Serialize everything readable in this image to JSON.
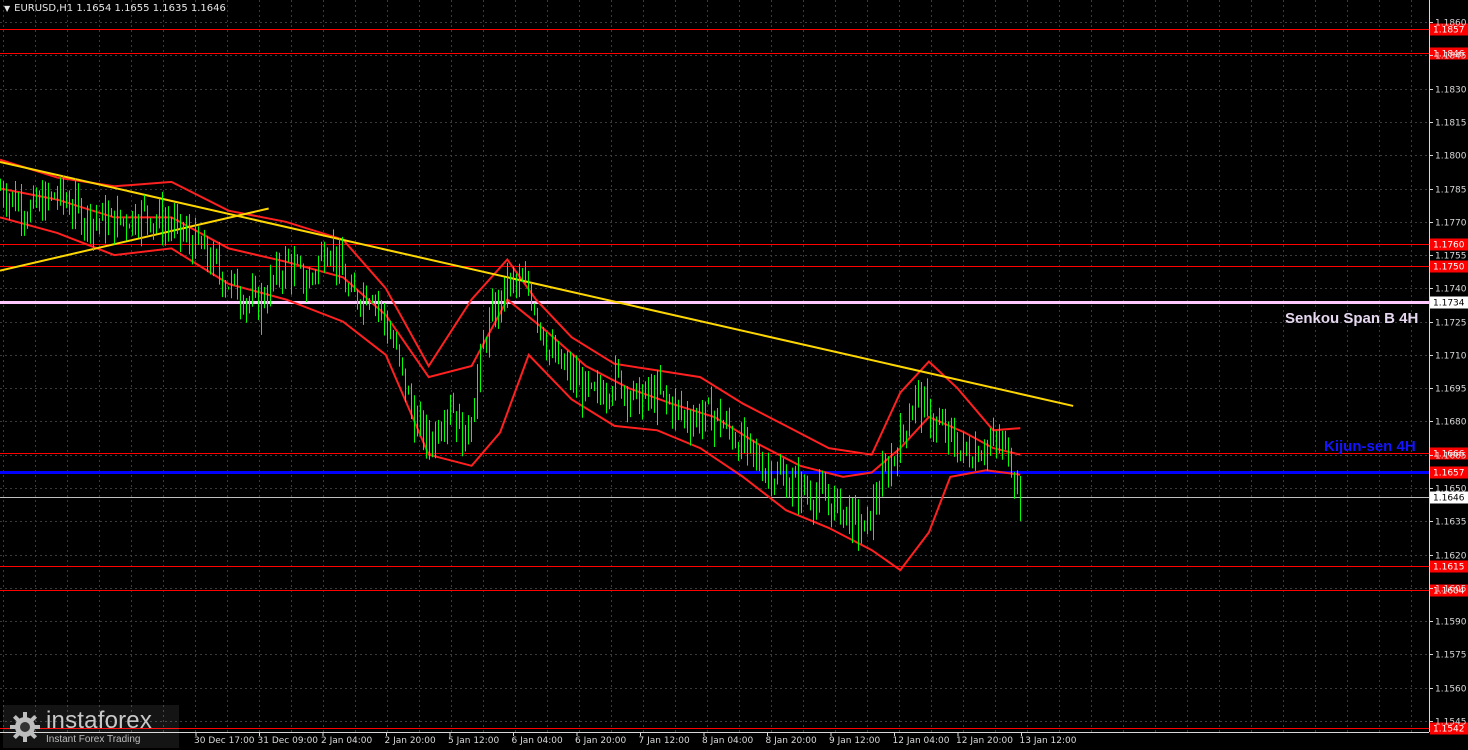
{
  "header": {
    "symbol": "EURUSD,H1",
    "ohlc": "1.1654 1.1655 1.1635 1.1646"
  },
  "watermark": {
    "brand": "instaforex",
    "tagline": "Instant Forex Trading"
  },
  "labels": {
    "senkou": "Senkou Span B 4H",
    "kijun": "Kijun-sen 4H"
  },
  "colors": {
    "background": "#000000",
    "grid": "#3a3a3a",
    "candles": "#00ff00",
    "support_resistance": "#ff0000",
    "senkou_span_b": "#ffc8ff",
    "kijun_sen": "#0000ff",
    "trend_line": "#ffd700",
    "bollinger_bands": "#ff2020",
    "current_price_line": "#bfbfbf"
  },
  "chart_data": {
    "type": "candlestick",
    "symbol": "EURUSD",
    "timeframe": "H1",
    "ylim": [
      1.154,
      1.187
    ],
    "y_ticks": [
      "1.1860",
      "1.1845",
      "1.1830",
      "1.1815",
      "1.1800",
      "1.1785",
      "1.1770",
      "1.1755",
      "1.1740",
      "1.1725",
      "1.1710",
      "1.1695",
      "1.1680",
      "1.1665",
      "1.1650",
      "1.1635",
      "1.1620",
      "1.1605",
      "1.1590",
      "1.1575",
      "1.1560",
      "1.1545"
    ],
    "x_ticks": [
      "30 Dec 17:00",
      "31 Dec 09:00",
      "2 Jan 04:00",
      "2 Jan 20:00",
      "5 Jan 12:00",
      "6 Jan 04:00",
      "6 Jan 20:00",
      "7 Jan 12:00",
      "8 Jan 04:00",
      "8 Jan 20:00",
      "9 Jan 12:00",
      "12 Jan 04:00",
      "12 Jan 20:00",
      "13 Jan 12:00"
    ],
    "price_levels": [
      {
        "label": "1.1857",
        "value": 1.1857,
        "type": "resistance"
      },
      {
        "label": "1.1846",
        "value": 1.1846,
        "type": "resistance"
      },
      {
        "label": "1.1760",
        "value": 1.176,
        "type": "resistance"
      },
      {
        "label": "1.1750",
        "value": 1.175,
        "type": "resistance"
      },
      {
        "label": "1.1734",
        "value": 1.1734,
        "type": "senkou_span_b"
      },
      {
        "label": "1.1666",
        "value": 1.1666,
        "type": "resistance"
      },
      {
        "label": "1.1657",
        "value": 1.1657,
        "type": "kijun_sen"
      },
      {
        "label": "1.1646",
        "value": 1.1646,
        "type": "current_price"
      },
      {
        "label": "1.1615",
        "value": 1.1615,
        "type": "support"
      },
      {
        "label": "1.1604",
        "value": 1.1604,
        "type": "support"
      },
      {
        "label": "1.1542",
        "value": 1.1542,
        "type": "support"
      }
    ],
    "trend_lines": [
      {
        "name": "descending",
        "points": [
          [
            0.0,
            1.1797
          ],
          [
            0.751,
            1.1687
          ]
        ]
      },
      {
        "name": "ascending",
        "points": [
          [
            0.0,
            1.1748
          ],
          [
            0.188,
            1.1776
          ]
        ]
      }
    ],
    "close_path": [
      [
        0.0,
        1.1785
      ],
      [
        0.02,
        1.1775
      ],
      [
        0.04,
        1.1782
      ],
      [
        0.06,
        1.1772
      ],
      [
        0.08,
        1.177
      ],
      [
        0.1,
        1.1774
      ],
      [
        0.12,
        1.1768
      ],
      [
        0.14,
        1.1758
      ],
      [
        0.16,
        1.1742
      ],
      [
        0.18,
        1.1732
      ],
      [
        0.2,
        1.1752
      ],
      [
        0.215,
        1.1742
      ],
      [
        0.23,
        1.1762
      ],
      [
        0.245,
        1.1735
      ],
      [
        0.26,
        1.174
      ],
      [
        0.275,
        1.1715
      ],
      [
        0.29,
        1.168
      ],
      [
        0.3,
        1.167
      ],
      [
        0.315,
        1.169
      ],
      [
        0.325,
        1.167
      ],
      [
        0.34,
        1.172
      ],
      [
        0.355,
        1.1742
      ],
      [
        0.37,
        1.174
      ],
      [
        0.385,
        1.171
      ],
      [
        0.4,
        1.17
      ],
      [
        0.415,
        1.169
      ],
      [
        0.43,
        1.17
      ],
      [
        0.445,
        1.169
      ],
      [
        0.46,
        1.1692
      ],
      [
        0.48,
        1.1682
      ],
      [
        0.5,
        1.1683
      ],
      [
        0.515,
        1.1672
      ],
      [
        0.53,
        1.1662
      ],
      [
        0.545,
        1.1655
      ],
      [
        0.56,
        1.165
      ],
      [
        0.575,
        1.1645
      ],
      [
        0.59,
        1.164
      ],
      [
        0.605,
        1.163
      ],
      [
        0.615,
        1.165
      ],
      [
        0.63,
        1.1672
      ],
      [
        0.64,
        1.1692
      ],
      [
        0.65,
        1.1682
      ],
      [
        0.66,
        1.1675
      ],
      [
        0.675,
        1.1665
      ],
      [
        0.69,
        1.167
      ],
      [
        0.705,
        1.1668
      ],
      [
        0.714,
        1.1646
      ]
    ],
    "bollinger_upper": [
      [
        0.0,
        1.1798
      ],
      [
        0.04,
        1.179
      ],
      [
        0.08,
        1.1786
      ],
      [
        0.12,
        1.1788
      ],
      [
        0.16,
        1.1775
      ],
      [
        0.2,
        1.177
      ],
      [
        0.24,
        1.1762
      ],
      [
        0.27,
        1.174
      ],
      [
        0.3,
        1.1705
      ],
      [
        0.33,
        1.1735
      ],
      [
        0.355,
        1.1753
      ],
      [
        0.375,
        1.1735
      ],
      [
        0.4,
        1.1718
      ],
      [
        0.43,
        1.1706
      ],
      [
        0.46,
        1.1703
      ],
      [
        0.49,
        1.17
      ],
      [
        0.52,
        1.1688
      ],
      [
        0.55,
        1.1678
      ],
      [
        0.58,
        1.1668
      ],
      [
        0.61,
        1.1665
      ],
      [
        0.63,
        1.1693
      ],
      [
        0.65,
        1.1707
      ],
      [
        0.67,
        1.1695
      ],
      [
        0.695,
        1.1676
      ],
      [
        0.714,
        1.1677
      ]
    ],
    "bollinger_middle": [
      [
        0.0,
        1.1785
      ],
      [
        0.04,
        1.178
      ],
      [
        0.08,
        1.1772
      ],
      [
        0.12,
        1.1772
      ],
      [
        0.16,
        1.1758
      ],
      [
        0.2,
        1.1752
      ],
      [
        0.24,
        1.1745
      ],
      [
        0.27,
        1.1728
      ],
      [
        0.3,
        1.17
      ],
      [
        0.33,
        1.1705
      ],
      [
        0.355,
        1.1735
      ],
      [
        0.38,
        1.1722
      ],
      [
        0.41,
        1.1705
      ],
      [
        0.44,
        1.1695
      ],
      [
        0.47,
        1.1688
      ],
      [
        0.5,
        1.1682
      ],
      [
        0.53,
        1.167
      ],
      [
        0.56,
        1.166
      ],
      [
        0.59,
        1.1655
      ],
      [
        0.61,
        1.1657
      ],
      [
        0.63,
        1.1668
      ],
      [
        0.65,
        1.1682
      ],
      [
        0.675,
        1.1675
      ],
      [
        0.695,
        1.1668
      ],
      [
        0.714,
        1.1665
      ]
    ],
    "bollinger_lower": [
      [
        0.0,
        1.1772
      ],
      [
        0.04,
        1.1765
      ],
      [
        0.08,
        1.1755
      ],
      [
        0.12,
        1.1758
      ],
      [
        0.16,
        1.1742
      ],
      [
        0.2,
        1.1735
      ],
      [
        0.24,
        1.1725
      ],
      [
        0.27,
        1.171
      ],
      [
        0.3,
        1.1665
      ],
      [
        0.33,
        1.166
      ],
      [
        0.35,
        1.1675
      ],
      [
        0.37,
        1.171
      ],
      [
        0.4,
        1.169
      ],
      [
        0.43,
        1.1678
      ],
      [
        0.46,
        1.1676
      ],
      [
        0.49,
        1.1668
      ],
      [
        0.52,
        1.1655
      ],
      [
        0.55,
        1.164
      ],
      [
        0.58,
        1.1632
      ],
      [
        0.61,
        1.1622
      ],
      [
        0.63,
        1.1613
      ],
      [
        0.65,
        1.163
      ],
      [
        0.665,
        1.1655
      ],
      [
        0.69,
        1.1658
      ],
      [
        0.714,
        1.1656
      ]
    ]
  }
}
